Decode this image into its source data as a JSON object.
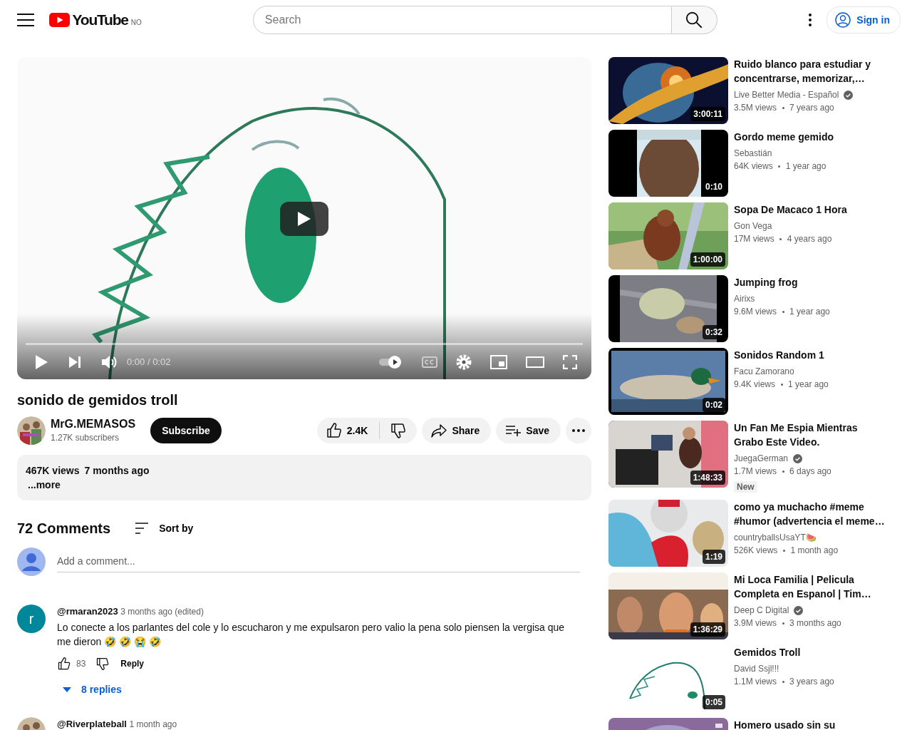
{
  "header": {
    "logo": "YouTube",
    "region": "NO",
    "search_placeholder": "Search",
    "sign_in": "Sign in"
  },
  "player": {
    "time": "0:00 / 0:02",
    "level": 0,
    "autoplay": true
  },
  "video": {
    "title": "sonido de gemidos troll",
    "channel": "MrG.MEMASOS",
    "subscribers": "1.27K subscribers",
    "subscribe": "Subscribe",
    "likes": "2.4K",
    "share": "Share",
    "save": "Save"
  },
  "description": {
    "views": "467K views",
    "age": "7 months ago",
    "more": "...more"
  },
  "comments": {
    "count": "72 Comments",
    "sort": "Sort by",
    "placeholder": "Add a comment...",
    "items": [
      {
        "kind": "letter",
        "initial": "r",
        "author": "@rmaran2023",
        "time": "3 months ago (edited)",
        "text": "Lo conecte a los parlantes del cole y lo escucharon y me expulsaron pero valio la pena solo piensen la vergisa que me dieron 🤣 🤣 😭 🤣",
        "likes": "83",
        "reply": "Reply",
        "replies": "8 replies"
      },
      {
        "kind": "picture",
        "author": "@Riverplateball",
        "time": "1 month ago"
      }
    ]
  },
  "related": [
    {
      "title": "Ruido blanco para estudiar y concentrarse, memorizar,…",
      "channel": "Live Better Media - Español",
      "verified": true,
      "views": "3.5M views",
      "age": "7 years ago",
      "duration": "3:00:11"
    },
    {
      "title": "Gordo meme gemido",
      "channel": "Sebastián",
      "verified": false,
      "views": "64K views",
      "age": "1 year ago",
      "duration": "0:10"
    },
    {
      "title": "Sopa De Macaco 1 Hora",
      "channel": "Gon Vega",
      "verified": false,
      "views": "17M views",
      "age": "4 years ago",
      "duration": "1:00:00"
    },
    {
      "title": "Jumping frog",
      "channel": "Airixs",
      "verified": false,
      "views": "9.6M views",
      "age": "1 year ago",
      "duration": "0:32"
    },
    {
      "title": "Sonidos Random 1",
      "channel": "Facu Zamorano",
      "verified": false,
      "views": "9.4K views",
      "age": "1 year ago",
      "duration": "0:02"
    },
    {
      "title": "Un Fan Me Espia Mientras Grabo Este Video.",
      "channel": "JuegaGerman",
      "verified": true,
      "views": "1.7M views",
      "age": "6 days ago",
      "duration": "1:48:33",
      "badge": "New"
    },
    {
      "title": "como ya muchacho #meme #humor (advertencia el meme…",
      "channel": "countryballsUsaYT🍉",
      "verified": false,
      "views": "526K views",
      "age": "1 month ago",
      "duration": "1:19"
    },
    {
      "title": "Mi Loca Familia | Pelicula Completa en Espanol | Tim…",
      "channel": "Deep C Digital",
      "verified": true,
      "views": "3.9M views",
      "age": "3 months ago",
      "duration": "1:36:29"
    },
    {
      "title": "Gemidos Troll",
      "channel": "David Ssjl!!!",
      "verified": false,
      "views": "1.1M views",
      "age": "3 years ago",
      "duration": "0:05"
    },
    {
      "title": "Homero usado sin su"
    }
  ]
}
